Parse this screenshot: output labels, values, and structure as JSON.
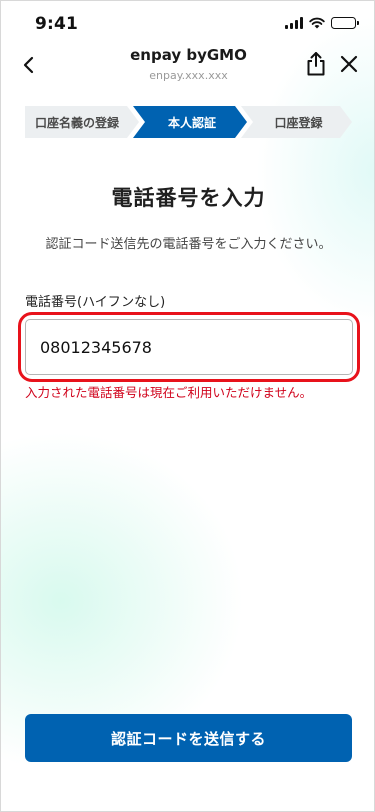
{
  "status_bar": {
    "time": "9:41"
  },
  "header": {
    "title": "enpay byGMO",
    "url": "enpay.xxx.xxx"
  },
  "stepper": {
    "steps": [
      {
        "label": "口座名義の登録",
        "active": false
      },
      {
        "label": "本人認証",
        "active": true
      },
      {
        "label": "口座登録",
        "active": false
      }
    ]
  },
  "main": {
    "title": "電話番号を入力",
    "description": "認証コード送信先の電話番号をご入力ください。",
    "phone_field": {
      "label": "電話番号(ハイフンなし)",
      "value": "08012345678"
    },
    "error_message": "入力された電話番号は現在ご利用いただけません。"
  },
  "actions": {
    "submit_label": "認証コードを送信する"
  },
  "colors": {
    "primary": "#0062b1",
    "step_inactive": "#eceff1",
    "error": "#d0021b",
    "highlight_border": "#e8121b"
  }
}
